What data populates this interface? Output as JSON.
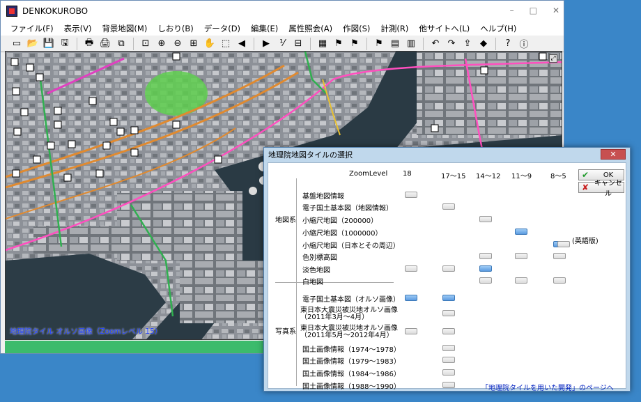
{
  "window": {
    "title": "DENKOKUROBO",
    "min": "–",
    "max": "□",
    "close": "✕"
  },
  "menu": [
    "ファイル(F)",
    "表示(V)",
    "背景地図(M)",
    "しおり(B)",
    "データ(D)",
    "編集(E)",
    "属性照会(A)",
    "作図(S)",
    "計測(R)",
    "他サイトへ(L)",
    "ヘルプ(H)"
  ],
  "toolbar_icons": [
    "new-icon",
    "open-icon",
    "save-icon",
    "saveas-icon",
    "print-icon",
    "printer-icon",
    "copy-icon",
    "fit-icon",
    "zoom-in-icon",
    "zoom-out-icon",
    "zoom-box-icon",
    "pan-icon",
    "select-icon",
    "back-icon",
    "forward-icon",
    "measure-icon",
    "calc-icon",
    "table-icon",
    "flag-icon",
    "flag2-icon",
    "flag3-icon",
    "layer-icon",
    "layer2-icon",
    "rotate-left-icon",
    "rotate-right-icon",
    "share-icon",
    "eraser-icon",
    "help-icon",
    "about-icon"
  ],
  "map": {
    "caption": "地理院タイル オルソ画像（Zoomレベル 15）"
  },
  "dialog": {
    "title": "地理院地図タイルの選択",
    "close": "✕",
    "zoom_label": "ZoomLevel",
    "columns": [
      "18",
      "17～15",
      "14～12",
      "11～9",
      "8～5"
    ],
    "groups": {
      "map": "地図系",
      "photo": "写真系"
    },
    "ok": "OK",
    "cancel": "キャンセル",
    "english_note": "(英語版)",
    "link": "「地理院タイルを用いた開発」のページへ",
    "map_rows": [
      {
        "label": "基盤地図情報",
        "cols": [
          0
        ],
        "selected": []
      },
      {
        "label": "電子国土基本図（地図情報）",
        "cols": [
          1
        ],
        "selected": []
      },
      {
        "label": "小縮尺地図（200000）",
        "cols": [
          2
        ],
        "selected": []
      },
      {
        "label": "小縮尺地図（1000000）",
        "cols": [
          3
        ],
        "selected": [
          3
        ]
      },
      {
        "label": "小縮尺地図（日本とその周辺）",
        "cols": [
          4
        ],
        "selected": [
          4
        ]
      },
      {
        "label": "色別標高図",
        "cols": [
          2,
          3,
          4
        ],
        "selected": []
      },
      {
        "label": "淡色地図",
        "cols": [
          0,
          1,
          2
        ],
        "selected": [
          2
        ]
      },
      {
        "label": "白地図",
        "cols": [
          2,
          3,
          4
        ],
        "selected": []
      }
    ],
    "photo_rows": [
      {
        "label": "電子国土基本図（オルソ画像）",
        "cols": [
          0,
          1
        ],
        "selected": [
          0,
          1
        ]
      },
      {
        "label": "東日本大震災被災地オルソ画像",
        "label2": "（2011年3月～4月）",
        "cols": [
          1
        ],
        "selected": []
      },
      {
        "label": "東日本大震災被災地オルソ画像",
        "label2": "（2011年5月～2012年4月）",
        "cols": [
          0,
          1
        ],
        "selected": []
      },
      {
        "label": "国土画像情報（1974～1978）",
        "cols": [
          1
        ],
        "selected": []
      },
      {
        "label": "国土画像情報（1979～1983）",
        "cols": [
          1
        ],
        "selected": []
      },
      {
        "label": "国土画像情報（1984～1986）",
        "cols": [
          1
        ],
        "selected": []
      },
      {
        "label": "国土画像情報（1988～1990）",
        "cols": [
          1
        ],
        "selected": []
      }
    ]
  }
}
